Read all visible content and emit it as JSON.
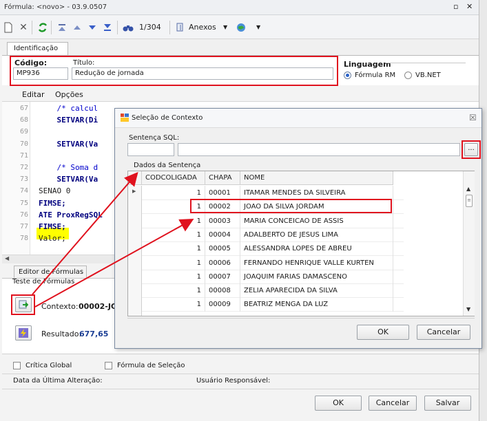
{
  "window": {
    "title": "Fórmula: <novo> - 03.9.0507",
    "controls": {
      "restore": "▫",
      "close": "✕"
    }
  },
  "toolbar": {
    "record_counter": "1/304",
    "attachments_label": "Anexos",
    "icons": [
      "new-icon",
      "delete-icon",
      "refresh-icon",
      "first-record-icon",
      "previous-record-icon",
      "next-record-icon",
      "last-record-icon",
      "binoculars-icon",
      "attachments-icon",
      "globe-icon"
    ]
  },
  "tabs": {
    "identification": "Identificação",
    "formula_editor": "Editor de Fórmulas"
  },
  "identification": {
    "code_label": "Código:",
    "code_value": "MP936",
    "title_label": "Título:",
    "title_value": "Redução de jornada",
    "language_label": "Linguagem",
    "language_options": [
      "Fórmula RM",
      "VB.NET"
    ],
    "language_selected": "Fórmula RM"
  },
  "editor_menu": [
    "Editar",
    "Opções"
  ],
  "code_lines": [
    {
      "n": "67",
      "text": "    /* calcul"
    },
    {
      "n": "68",
      "text": "    SETVAR(Di"
    },
    {
      "n": "69",
      "text": ""
    },
    {
      "n": "70",
      "text": "    SETVAR(Va"
    },
    {
      "n": "71",
      "text": ""
    },
    {
      "n": "72",
      "text": "    /* Soma d"
    },
    {
      "n": "73",
      "text": "    SETVAR(Va"
    },
    {
      "n": "74",
      "text": "SENAO 0"
    },
    {
      "n": "75",
      "text": "FIMSE;"
    },
    {
      "n": "76",
      "text": "ATE ProxRegSQL"
    },
    {
      "n": "77",
      "text": "FIMSE;"
    },
    {
      "n": "78",
      "text": "Valor;"
    }
  ],
  "test_section": {
    "title": "Teste de Fórmulas",
    "context_label": "Contexto:",
    "context_value": "00002-JC",
    "result_label": "Resultado:",
    "result_value": "677,65"
  },
  "footer": {
    "global_critic": "Crítica Global",
    "selection_formula": "Fórmula de Seleção",
    "last_change_label": "Data da Última Alteração:",
    "responsible_label": "Usuário Responsável:",
    "ok": "OK",
    "cancel": "Cancelar",
    "save": "Salvar"
  },
  "dialog": {
    "title": "Seleção de Contexto",
    "sql_label": "Sentença SQL:",
    "browse_button": "...",
    "data_label": "Dados da Sentença",
    "columns": [
      "CODCOLIGADA",
      "CHAPA",
      "NOME"
    ],
    "rows": [
      {
        "cod": "1",
        "chapa": "00001",
        "nome": "ITAMAR MENDES DA SILVEIRA"
      },
      {
        "cod": "1",
        "chapa": "00002",
        "nome": "JOAO DA SILVA JORDAM"
      },
      {
        "cod": "1",
        "chapa": "00003",
        "nome": "MARIA CONCEICAO DE ASSIS"
      },
      {
        "cod": "1",
        "chapa": "00004",
        "nome": "ADALBERTO DE JESUS LIMA"
      },
      {
        "cod": "1",
        "chapa": "00005",
        "nome": "ALESSANDRA LOPES DE ABREU"
      },
      {
        "cod": "1",
        "chapa": "00006",
        "nome": "FERNANDO HENRIQUE VALLE KURTEN"
      },
      {
        "cod": "1",
        "chapa": "00007",
        "nome": "JOAQUIM FARIAS DAMASCENO"
      },
      {
        "cod": "1",
        "chapa": "00008",
        "nome": "ZELIA APARECIDA DA SILVA"
      },
      {
        "cod": "1",
        "chapa": "00009",
        "nome": "BEATRIZ MENGA DA LUZ"
      }
    ],
    "ok": "OK",
    "cancel": "Cancelar",
    "close": "☒"
  },
  "colors": {
    "highlight_red": "#e0121e",
    "code_highlight": "#ffff00",
    "keyword": "#00007f"
  }
}
